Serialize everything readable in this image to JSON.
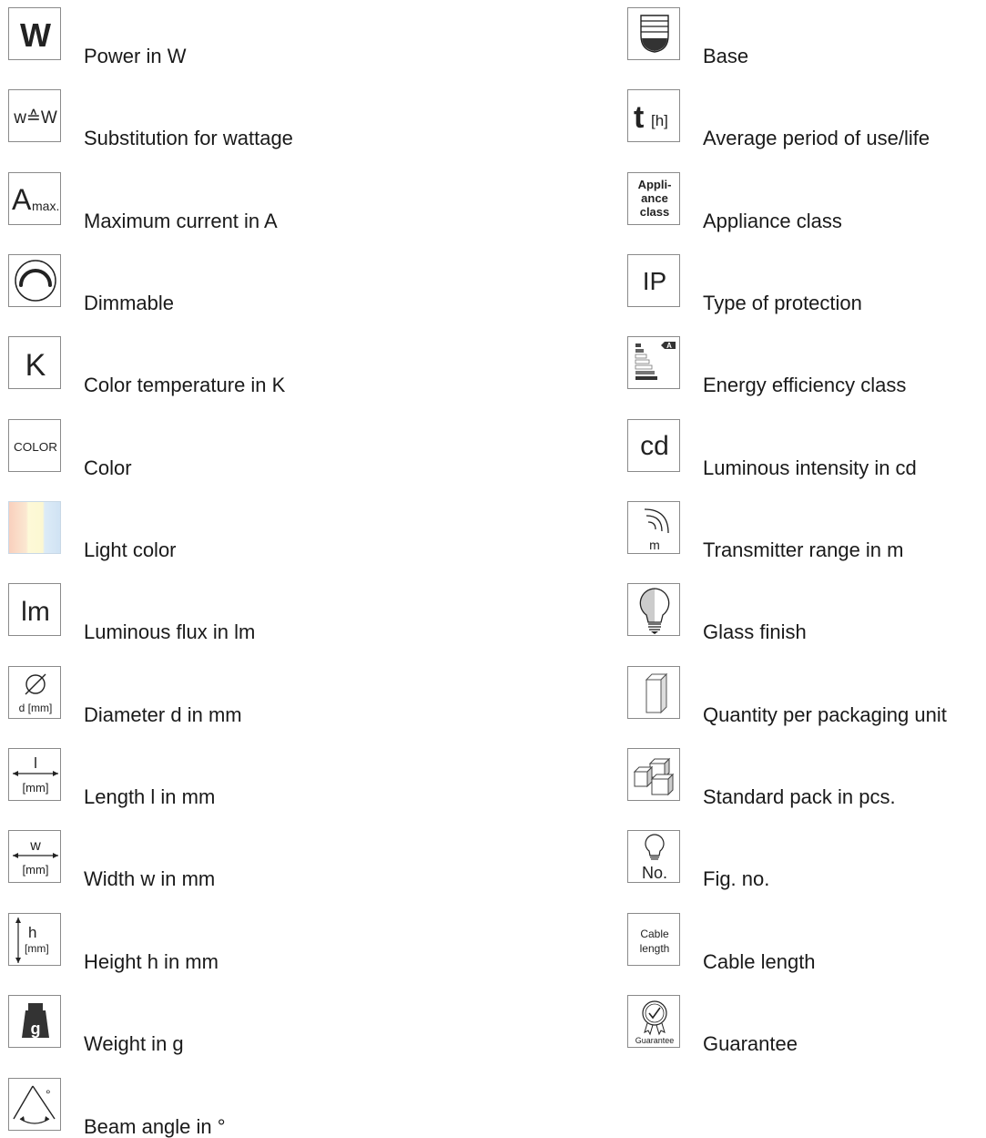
{
  "left_column": {
    "items": [
      {
        "label": "Power in W",
        "icon": "power-watt-icon",
        "symbol": "W"
      },
      {
        "label": "Substitution for wattage",
        "icon": "wattage-substitution-icon",
        "symbol": "w≙W"
      },
      {
        "label": "Maximum current in A",
        "icon": "max-current-icon",
        "symbol": "A",
        "sub": "max."
      },
      {
        "label": "Dimmable",
        "icon": "dimmable-icon"
      },
      {
        "label": "Color temperature in K",
        "icon": "color-temperature-icon",
        "symbol": "K"
      },
      {
        "label": "Color",
        "icon": "color-icon",
        "symbol": "COLOR"
      },
      {
        "label": "Light color",
        "icon": "light-color-swatch-icon",
        "colors": [
          "#f9d9c8",
          "#fdf8d6",
          "#d6e8f6"
        ]
      },
      {
        "label": "Luminous flux in lm",
        "icon": "luminous-flux-icon",
        "symbol": "lm"
      },
      {
        "label": "Diameter d in mm",
        "icon": "diameter-icon",
        "symbol": "d [mm]"
      },
      {
        "label": "Length l in mm",
        "icon": "length-icon",
        "symbol": "l",
        "unit": "[mm]"
      },
      {
        "label": "Width w in mm",
        "icon": "width-icon",
        "symbol": "w",
        "unit": "[mm]"
      },
      {
        "label": "Height h in mm",
        "icon": "height-icon",
        "symbol": "h",
        "unit": "[mm]"
      },
      {
        "label": "Weight in g",
        "icon": "weight-icon",
        "symbol": "g"
      },
      {
        "label": "Beam angle in °",
        "icon": "beam-angle-icon",
        "symbol": "°"
      }
    ]
  },
  "right_column": {
    "items": [
      {
        "label": "Base",
        "icon": "lamp-base-icon"
      },
      {
        "label": "Average period of use/life",
        "icon": "lifetime-icon",
        "symbol": "t",
        "unit": "[h]"
      },
      {
        "label": "Appliance class",
        "icon": "appliance-class-icon",
        "symbol_lines": [
          "Appli-",
          "ance",
          "class"
        ]
      },
      {
        "label": "Type of protection",
        "icon": "ip-protection-icon",
        "symbol": "IP"
      },
      {
        "label": "Energy efficiency class",
        "icon": "energy-label-icon",
        "symbol": "A"
      },
      {
        "label": "Luminous intensity in cd",
        "icon": "luminous-intensity-icon",
        "symbol": "cd"
      },
      {
        "label": "Transmitter range in m",
        "icon": "transmitter-range-icon",
        "symbol": "m"
      },
      {
        "label": "Glass finish",
        "icon": "glass-finish-bulb-icon"
      },
      {
        "label": "Quantity per packaging unit",
        "icon": "packaging-unit-box-icon"
      },
      {
        "label": "Standard pack in pcs.",
        "icon": "standard-pack-boxes-icon"
      },
      {
        "label": "Fig. no.",
        "icon": "figure-number-icon",
        "symbol": "No."
      },
      {
        "label": "Cable length",
        "icon": "cable-length-icon",
        "symbol_lines": [
          "Cable",
          "length"
        ]
      },
      {
        "label": "Guarantee",
        "icon": "guarantee-seal-icon",
        "symbol": "Guarantee"
      }
    ]
  }
}
